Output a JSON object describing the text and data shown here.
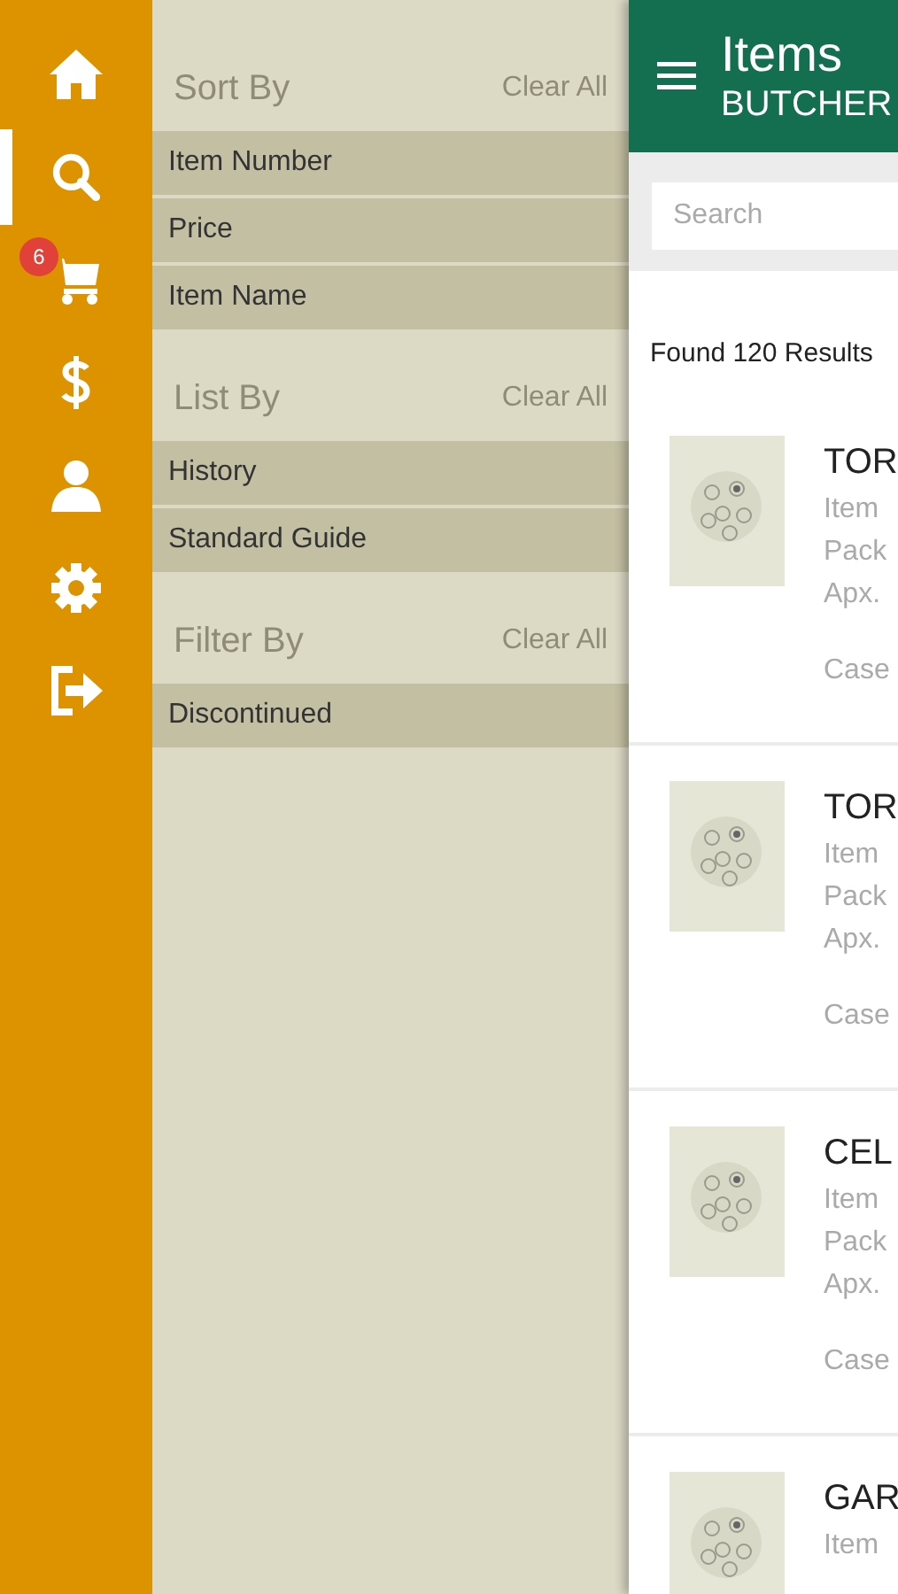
{
  "nav": [
    {
      "kind": "home",
      "selected": false
    },
    {
      "kind": "search",
      "selected": true
    },
    {
      "kind": "cart",
      "selected": false,
      "badge": "6"
    },
    {
      "kind": "dollar",
      "selected": false
    },
    {
      "kind": "user",
      "selected": false
    },
    {
      "kind": "settings",
      "selected": false
    },
    {
      "kind": "logout",
      "selected": false
    }
  ],
  "filter_panel": {
    "sections": [
      {
        "title": "Sort By",
        "clear": "Clear All",
        "options": [
          "Item Number",
          "Price",
          "Item Name"
        ]
      },
      {
        "title": "List By",
        "clear": "Clear All",
        "options": [
          "History",
          "Standard Guide"
        ]
      },
      {
        "title": "Filter By",
        "clear": "Clear All",
        "options": [
          "Discontinued"
        ]
      }
    ]
  },
  "header": {
    "title": "Items",
    "subtitle": "BUTCHER"
  },
  "search": {
    "placeholder": "Search"
  },
  "results_count": "Found 120 Results",
  "items": [
    {
      "kind": "picture",
      "title": "TOR",
      "lines": [
        "Item",
        "Pack",
        "Apx."
      ],
      "case": "Case"
    },
    {
      "kind": "picture",
      "title": "TOR",
      "lines": [
        "Item",
        "Pack",
        "Apx."
      ],
      "case": "Case"
    },
    {
      "kind": "picture",
      "title": "CEL",
      "lines": [
        "Item",
        "Pack",
        "Apx."
      ],
      "case": "Case"
    },
    {
      "kind": "picture",
      "title": "GAR",
      "lines": [
        "Item"
      ]
    }
  ]
}
